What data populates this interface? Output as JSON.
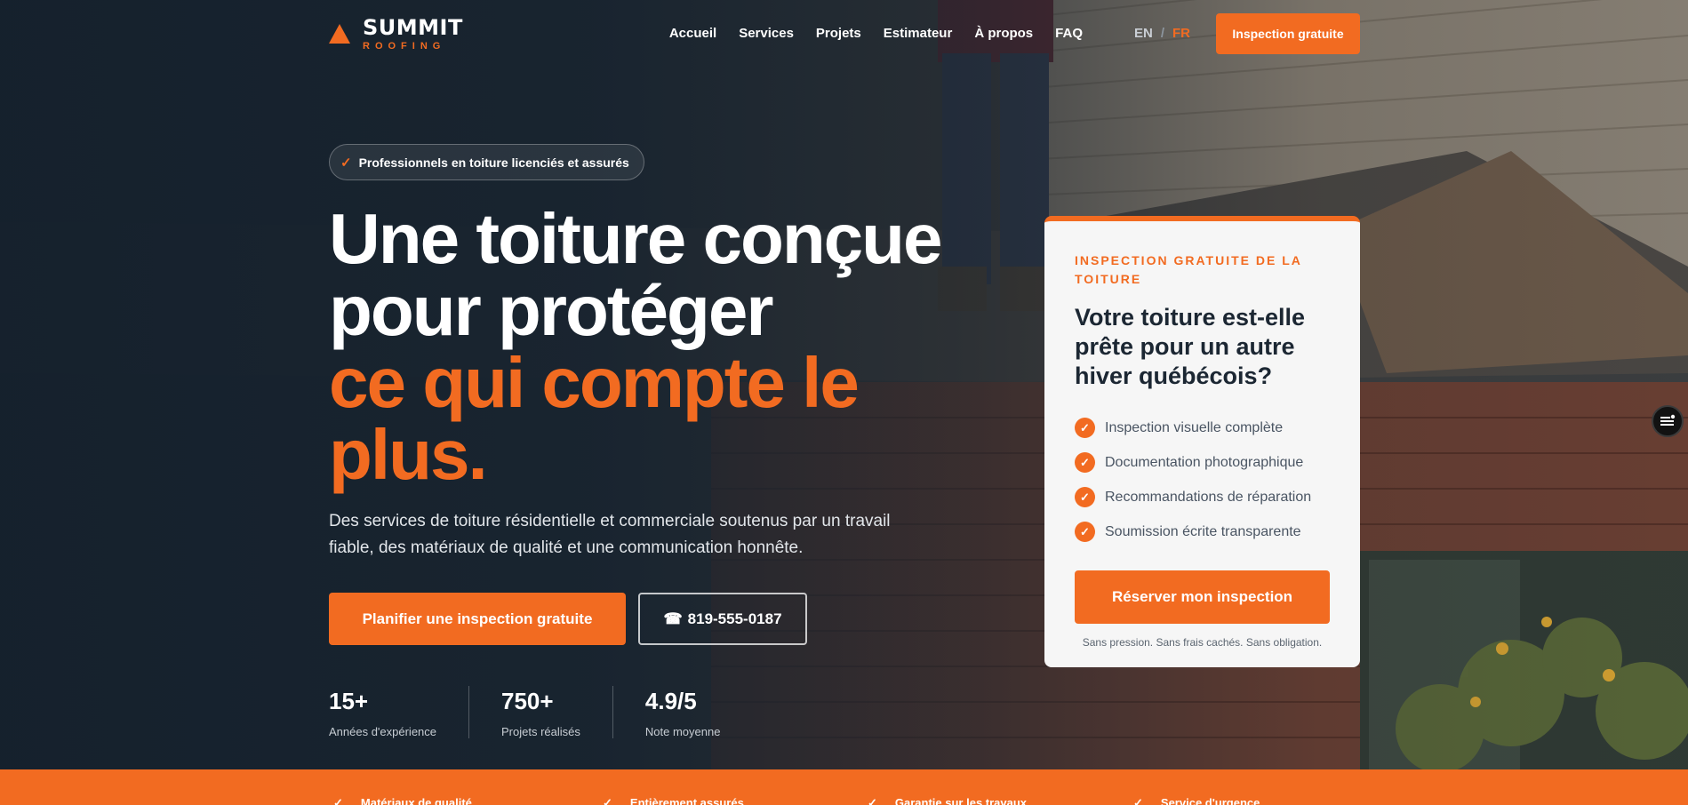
{
  "nav": {
    "logo_name": "SUMMIT",
    "logo_sub": "ROOFING",
    "links": [
      "Accueil",
      "Services",
      "Projets",
      "Estimateur",
      "À propos",
      "FAQ"
    ],
    "lang_en": "EN",
    "lang_sep": "/",
    "lang_fr": "FR",
    "cta": "Inspection gratuite"
  },
  "hero": {
    "badge_check": "✓",
    "badge": "Professionnels en toiture licenciés et assurés",
    "title_line1": "Une toiture conçue pour protéger",
    "title_accent": "ce qui compte le plus.",
    "description": "Des services de toiture résidentielle et commerciale soutenus par un travail fiable, des matériaux de qualité et une communication honnête.",
    "primary_button": "Planifier une inspection gratuite",
    "phone_icon": "☎",
    "phone": "819-555-0187",
    "stats": [
      {
        "value": "15+",
        "label": "Années d'expérience"
      },
      {
        "value": "750+",
        "label": "Projets réalisés"
      },
      {
        "value": "4.9/5",
        "label": "Note moyenne"
      }
    ]
  },
  "card": {
    "eyebrow": "INSPECTION GRATUITE DE LA TOITURE",
    "title": "Votre toiture est-elle prête pour un autre hiver québécois?",
    "check": "✓",
    "items": [
      "Inspection visuelle complète",
      "Documentation photographique",
      "Recommandations de réparation",
      "Soumission écrite transparente"
    ],
    "cta": "Réserver mon inspection",
    "note": "Sans pression. Sans frais cachés. Sans obligation."
  },
  "features": [
    {
      "icon": "✓",
      "label": "Matériaux de qualité"
    },
    {
      "icon": "✓",
      "label": "Entièrement assurés"
    },
    {
      "icon": "✓",
      "label": "Garantie sur les travaux"
    },
    {
      "icon": "✓",
      "label": "Service d'urgence"
    }
  ],
  "colors": {
    "accent": "#f26b21",
    "dark": "#1c2733",
    "card_bg": "#f6f6f6"
  },
  "icons": {
    "logo": "triangle-logo-icon",
    "widget": "accessibility-menu-icon"
  }
}
